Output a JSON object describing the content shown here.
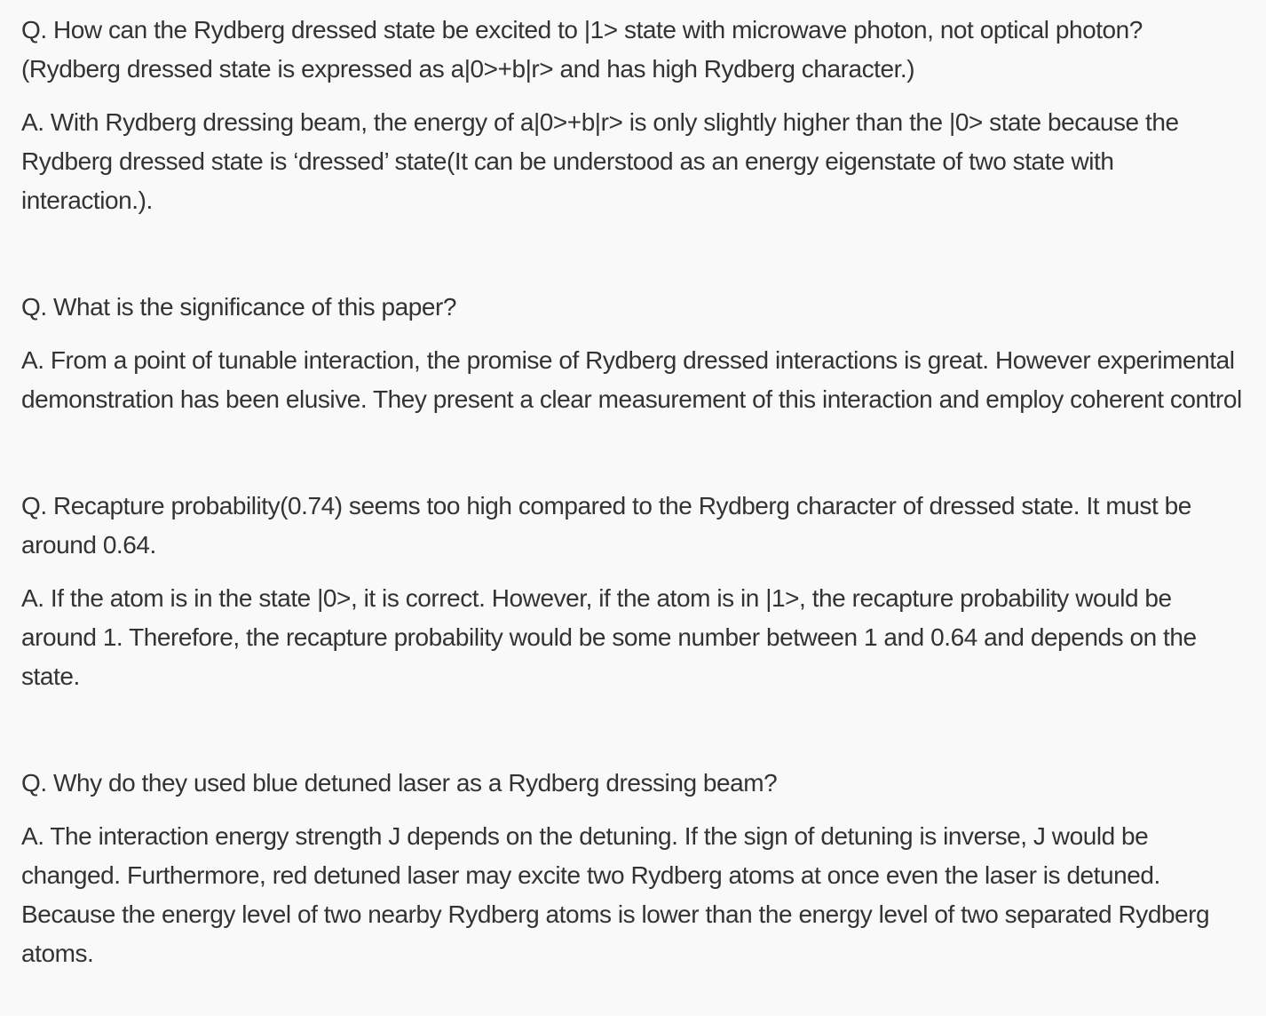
{
  "qa": [
    {
      "question": "Q. How can the Rydberg dressed state be excited to |1> state with microwave photon, not optical photon? (Rydberg dressed state is expressed as a|0>+b|r> and has high Rydberg character.)",
      "answer": "A. With Rydberg dressing beam, the energy of a|0>+b|r> is only slightly higher than the |0> state because the Rydberg dressed state is ‘dressed’ state(It can be understood as an energy eigenstate of two state with interaction.)."
    },
    {
      "question": "Q. What is the significance of this paper?",
      "answer": "A. From a point of tunable interaction, the promise of Rydberg dressed interactions is great. However experimental demonstration has been elusive. They present a clear measurement of this interaction and employ coherent control"
    },
    {
      "question": "Q. Recapture probability(0.74) seems too high compared to the Rydberg character of dressed state. It must be around 0.64.",
      "answer": "A. If the atom is in the state |0>, it is correct. However, if the atom is in |1>, the recapture probability would be around 1. Therefore, the recapture probability would be some number between 1 and 0.64 and depends on the state."
    },
    {
      "question": "Q. Why do they used blue detuned laser as a Rydberg dressing beam?",
      "answer": "A. The interaction energy strength J depends on the detuning. If the sign of detuning is inverse, J would be changed. Furthermore, red detuned laser may excite two Rydberg atoms at once even the laser is detuned. Because the energy level of two nearby Rydberg atoms is lower than the energy level of two separated Rydberg atoms."
    }
  ]
}
